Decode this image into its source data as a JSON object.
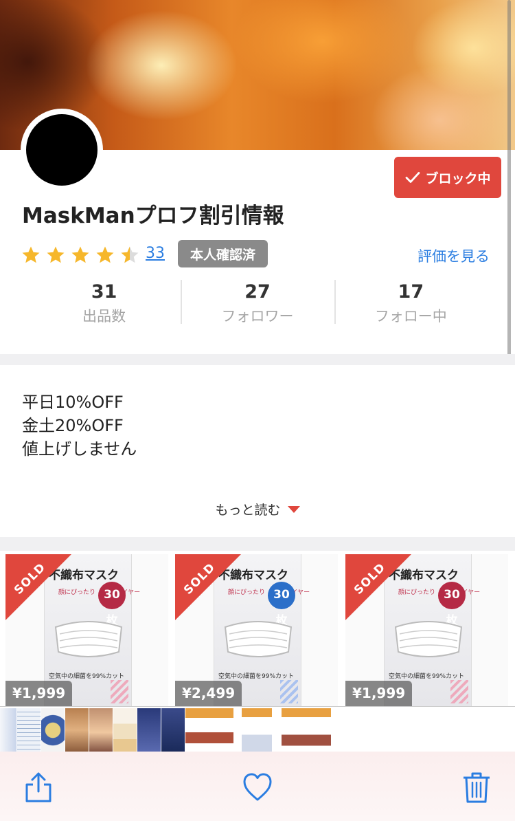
{
  "header": {
    "block_button_label": "ブロック中"
  },
  "profile": {
    "username": "MaskManプロフ割引情報",
    "rating_stars": 4.5,
    "review_count": "33",
    "verified_label": "本人確認済",
    "see_reviews_label": "評価を見る"
  },
  "stats": [
    {
      "value": "31",
      "label": "出品数"
    },
    {
      "value": "27",
      "label": "フォロワー"
    },
    {
      "value": "17",
      "label": "フォロー中"
    }
  ],
  "bio": {
    "lines": [
      "平日10%OFF",
      "金土20%OFF",
      "値上げしません"
    ],
    "read_more_label": "もっと読む"
  },
  "listings": [
    {
      "sold_label": "SOLD",
      "price": "¥1,999",
      "box_title": "不織布マスク",
      "box_tagline": "顔にぴったり ノーズワイヤー",
      "box_count": "30枚",
      "box_claim": "空気中の細菌を99%カット",
      "color": "#b52a45"
    },
    {
      "sold_label": "SOLD",
      "price": "¥2,499",
      "box_title": "不織布マスク",
      "box_tagline": "顔にぴったり ノーズワイヤー",
      "box_count": "30枚",
      "box_claim": "空気中の細菌を99%カット",
      "color": "#2b6fc9"
    },
    {
      "sold_label": "SOLD",
      "price": "¥1,999",
      "box_title": "不織布マスク",
      "box_tagline": "顔にぴったり ノーズワイヤー",
      "box_count": "30枚",
      "box_claim": "空気中の細菌を99%カット",
      "color": "#b52a45"
    }
  ],
  "toolbar": {
    "icons": [
      "share-icon",
      "heart-icon",
      "trash-icon"
    ]
  },
  "colors": {
    "accent_red": "#e0473d",
    "link_blue": "#2a7de1",
    "star_yellow": "#f6b72b",
    "badge_gray": "#8a8a8a"
  }
}
